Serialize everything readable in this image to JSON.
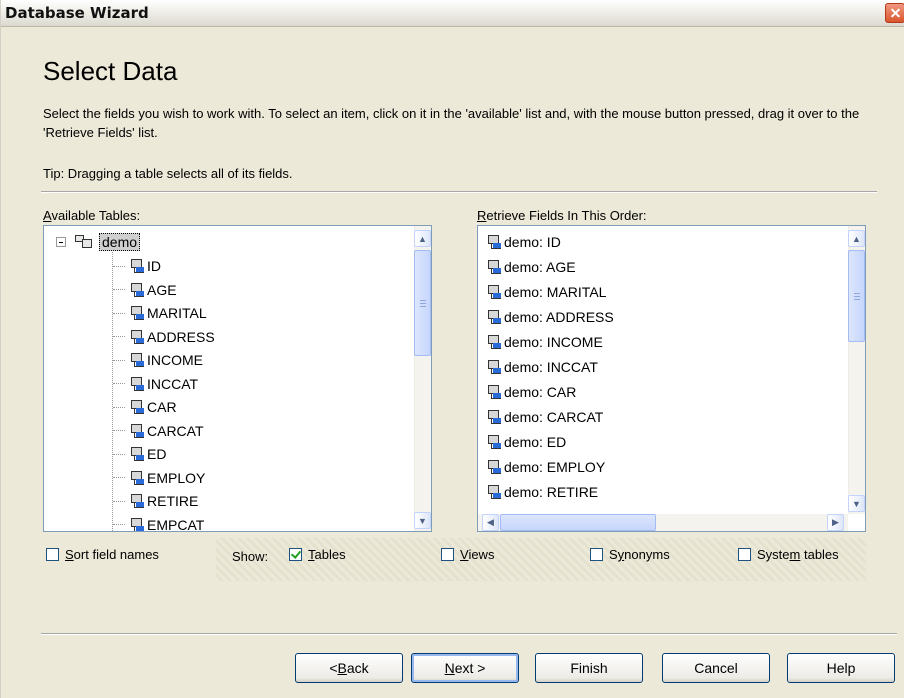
{
  "window": {
    "title": "Database Wizard"
  },
  "page": {
    "heading": "Select Data",
    "description": "Select the fields you wish to work with. To select an item, click on it in the 'available' list and, with the mouse button pressed, drag it over to the 'Retrieve Fields' list.",
    "tip": "Tip: Dragging a table selects all of its fields."
  },
  "available": {
    "label_mnemonic": "A",
    "label_rest": "vailable Tables:",
    "table_name": "demo",
    "fields": [
      "ID",
      "AGE",
      "MARITAL",
      "ADDRESS",
      "INCOME",
      "INCCAT",
      "CAR",
      "CARCAT",
      "ED",
      "EMPLOY",
      "RETIRE",
      "EMPCAT"
    ]
  },
  "retrieve": {
    "label_mnemonic": "R",
    "label_rest": "etrieve Fields In This Order:",
    "fields": [
      "demo: ID",
      "demo: AGE",
      "demo: MARITAL",
      "demo: ADDRESS",
      "demo: INCOME",
      "demo: INCCAT",
      "demo: CAR",
      "demo: CARCAT",
      "demo: ED",
      "demo: EMPLOY",
      "demo: RETIRE"
    ]
  },
  "options": {
    "sort": {
      "mn": "S",
      "rest": "ort field names",
      "checked": false
    },
    "show_label": "Show:",
    "tables": {
      "mn": "T",
      "rest": "ables",
      "checked": true
    },
    "views": {
      "mn": "V",
      "rest": "iews",
      "checked": false
    },
    "synonyms": {
      "pre": "S",
      "mn": "y",
      "rest": "nonyms",
      "checked": false
    },
    "system": {
      "pre": "Syste",
      "mn": "m",
      "rest": " tables",
      "checked": false
    }
  },
  "buttons": {
    "back": {
      "pre": "< ",
      "mn": "B",
      "rest": "ack"
    },
    "next": {
      "mn": "N",
      "rest": "ext >"
    },
    "finish": "Finish",
    "cancel": "Cancel",
    "help": "Help"
  },
  "icons": {
    "close": "close-icon",
    "field": "field-icon",
    "table": "table-icon",
    "collapse": "minus-icon",
    "scroll_up": "chevron-up-icon",
    "scroll_down": "chevron-down-icon",
    "scroll_left": "chevron-left-icon",
    "scroll_right": "chevron-right-icon"
  }
}
